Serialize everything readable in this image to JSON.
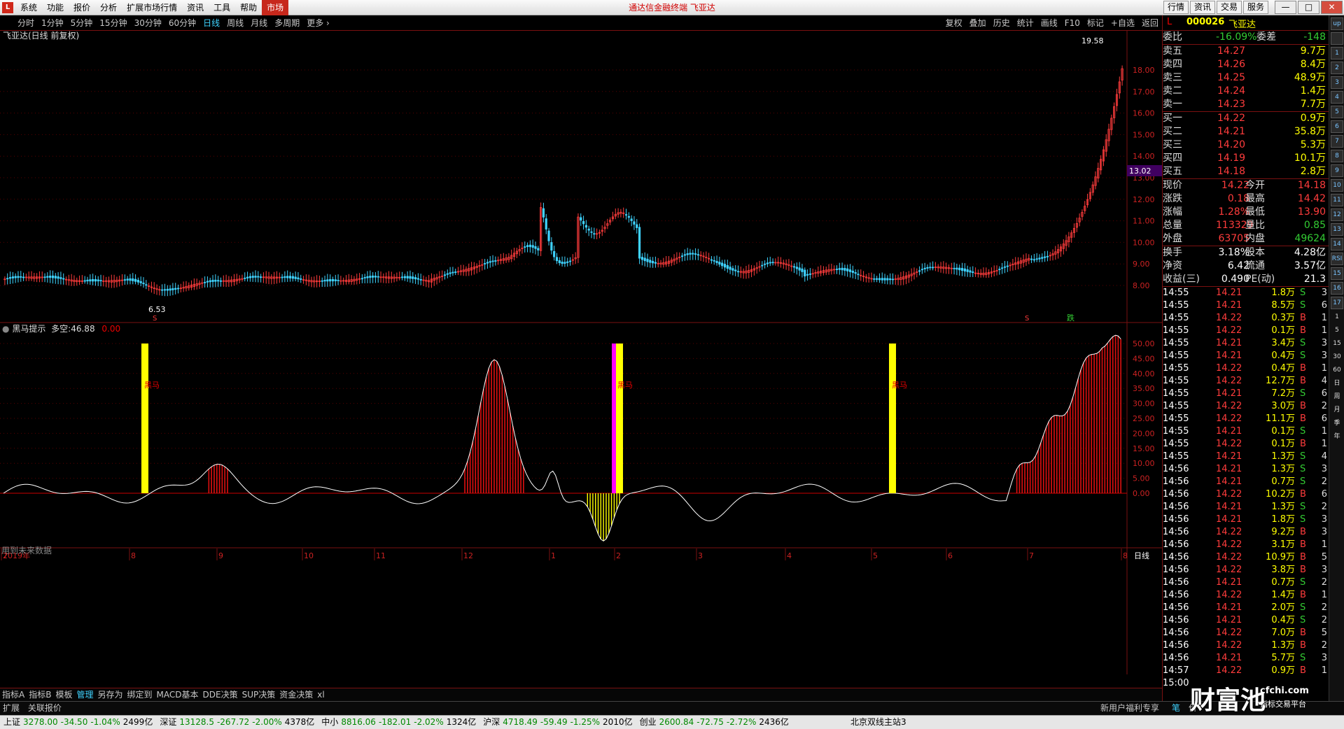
{
  "app": {
    "logo": "L",
    "title": "通达信金融终端  飞亚达",
    "menu": [
      "系统",
      "功能",
      "报价",
      "分析",
      "扩展市场行情",
      "资讯",
      "工具",
      "帮助",
      "市场"
    ],
    "top_buttons": [
      "行情",
      "资讯",
      "交易",
      "服务"
    ],
    "window_buttons": [
      "—",
      "□",
      "✕"
    ]
  },
  "periods": {
    "items": [
      "分时",
      "1分钟",
      "5分钟",
      "15分钟",
      "30分钟",
      "60分钟",
      "日线",
      "周线",
      "月线",
      "多周期",
      "更多"
    ],
    "selected": "日线",
    "more_icon": "chevron-right"
  },
  "tools": [
    "复权",
    "叠加",
    "历史",
    "统计",
    "画线",
    "F10",
    "标记",
    "+自选",
    "返回"
  ],
  "main_chart": {
    "title": "飞亚达(日线 前复权)",
    "high_label": "19.58",
    "low_label": "6.53",
    "price_tag": "13.02",
    "yticks": [
      "18.00",
      "17.00",
      "16.00",
      "15.00",
      "14.00",
      "13.00",
      "12.00",
      "11.00",
      "10.00",
      "9.00",
      "8.00"
    ],
    "marks": [
      "S",
      "S",
      "跌"
    ]
  },
  "indicator": {
    "name": "黑马提示",
    "label": "多空",
    "value": "46.88",
    "value2": "0.00",
    "yticks": [
      "50.00",
      "45.00",
      "40.00",
      "35.00",
      "30.00",
      "25.00",
      "20.00",
      "15.00",
      "10.00",
      "5.00",
      "0.00"
    ],
    "signal_text": "黑马",
    "future_note": "用到未来数据"
  },
  "x_axis": {
    "labels": [
      "2019年",
      "7",
      "8",
      "9",
      "10",
      "11",
      "12",
      "1",
      "2",
      "3",
      "4",
      "5",
      "6",
      "7",
      "8"
    ],
    "period": "日线"
  },
  "quote": {
    "code": "000026",
    "name": "飞亚达",
    "weibi_label": "委比",
    "weibi": "-16.09%",
    "weicha_label": "委差",
    "weicha": "-148",
    "sells": [
      {
        "label": "卖五",
        "price": "14.27",
        "vol": "9.7万"
      },
      {
        "label": "卖四",
        "price": "14.26",
        "vol": "8.4万"
      },
      {
        "label": "卖三",
        "price": "14.25",
        "vol": "48.9万"
      },
      {
        "label": "卖二",
        "price": "14.24",
        "vol": "1.4万"
      },
      {
        "label": "卖一",
        "price": "14.23",
        "vol": "7.7万"
      }
    ],
    "buys": [
      {
        "label": "买一",
        "price": "14.22",
        "vol": "0.9万"
      },
      {
        "label": "买二",
        "price": "14.21",
        "vol": "35.8万"
      },
      {
        "label": "买三",
        "price": "14.20",
        "vol": "5.3万"
      },
      {
        "label": "买四",
        "price": "14.19",
        "vol": "10.1万"
      },
      {
        "label": "买五",
        "price": "14.18",
        "vol": "2.8万"
      }
    ],
    "stats": [
      [
        "现价",
        "14.22",
        "今开",
        "14.18"
      ],
      [
        "涨跌",
        "0.18",
        "最高",
        "14.42"
      ],
      [
        "涨幅",
        "1.28%",
        "最低",
        "13.90"
      ],
      [
        "总量",
        "113329",
        "量比",
        "0.85"
      ],
      [
        "外盘",
        "63705",
        "内盘",
        "49624"
      ]
    ],
    "stats2": [
      [
        "换手",
        "3.18%",
        "股本",
        "4.28亿"
      ],
      [
        "净资",
        "6.42",
        "流通",
        "3.57亿"
      ],
      [
        "收益(三)",
        "0.490",
        "PE(动)",
        "21.3"
      ]
    ]
  },
  "ticks": [
    [
      "14:55",
      "14.21",
      "1.8万",
      "S",
      "3"
    ],
    [
      "14:55",
      "14.21",
      "8.5万",
      "S",
      "6"
    ],
    [
      "14:55",
      "14.22",
      "0.3万",
      "B",
      "1"
    ],
    [
      "14:55",
      "14.22",
      "0.1万",
      "B",
      "1"
    ],
    [
      "14:55",
      "14.21",
      "3.4万",
      "S",
      "3"
    ],
    [
      "14:55",
      "14.21",
      "0.4万",
      "S",
      "3"
    ],
    [
      "14:55",
      "14.22",
      "0.4万",
      "B",
      "1"
    ],
    [
      "14:55",
      "14.22",
      "12.7万",
      "B",
      "4"
    ],
    [
      "14:55",
      "14.21",
      "7.2万",
      "S",
      "6"
    ],
    [
      "14:55",
      "14.22",
      "3.0万",
      "B",
      "2"
    ],
    [
      "14:55",
      "14.22",
      "11.1万",
      "B",
      "6"
    ],
    [
      "14:55",
      "14.21",
      "0.1万",
      "S",
      "1"
    ],
    [
      "14:55",
      "14.22",
      "0.1万",
      "B",
      "1"
    ],
    [
      "14:55",
      "14.21",
      "1.3万",
      "S",
      "4"
    ],
    [
      "14:56",
      "14.21",
      "1.3万",
      "S",
      "3"
    ],
    [
      "14:56",
      "14.21",
      "0.7万",
      "S",
      "2"
    ],
    [
      "14:56",
      "14.22",
      "10.2万",
      "B",
      "6"
    ],
    [
      "14:56",
      "14.21",
      "1.3万",
      "S",
      "2"
    ],
    [
      "14:56",
      "14.21",
      "1.8万",
      "S",
      "3"
    ],
    [
      "14:56",
      "14.22",
      "9.2万",
      "B",
      "3"
    ],
    [
      "14:56",
      "14.22",
      "3.1万",
      "B",
      "1"
    ],
    [
      "14:56",
      "14.22",
      "10.9万",
      "B",
      "5"
    ],
    [
      "14:56",
      "14.22",
      "3.8万",
      "B",
      "3"
    ],
    [
      "14:56",
      "14.21",
      "0.7万",
      "S",
      "2"
    ],
    [
      "14:56",
      "14.22",
      "1.4万",
      "B",
      "1"
    ],
    [
      "14:56",
      "14.21",
      "2.0万",
      "S",
      "2"
    ],
    [
      "14:56",
      "14.21",
      "0.4万",
      "S",
      "2"
    ],
    [
      "14:56",
      "14.22",
      "7.0万",
      "B",
      "5"
    ],
    [
      "14:56",
      "14.22",
      "1.3万",
      "B",
      "2"
    ],
    [
      "14:56",
      "14.21",
      "5.7万",
      "S",
      "3"
    ],
    [
      "14:57",
      "14.22",
      "0.9万",
      "B",
      "1"
    ],
    [
      "15:00",
      "",
      "",
      "",
      ""
    ]
  ],
  "bottom_tabs": [
    "指标A",
    "指标B",
    "模板",
    "管理",
    "另存为",
    "绑定到",
    "MACD基本",
    "DDE决策",
    "SUP决策",
    "资金决策",
    "xl"
  ],
  "bottom_tabs_selected": "管理",
  "bottom2": {
    "left": [
      "扩展",
      "关联报价"
    ],
    "right": [
      "新用户福利专享",
      "笔",
      "价",
      "细",
      "势",
      "联",
      "值"
    ]
  },
  "statusbar": [
    [
      "上证",
      "3278.00",
      "-34.50",
      "-1.04%",
      "2499亿"
    ],
    [
      "深证",
      "13128.5",
      "-267.72",
      "-2.00%",
      "4378亿"
    ],
    [
      "中小",
      "8816.06",
      "-182.01",
      "-2.02%",
      "1324亿"
    ],
    [
      "沪深",
      "4718.49",
      "-59.49",
      "-1.25%",
      "2010亿"
    ],
    [
      "创业",
      "2600.84",
      "-72.75",
      "-2.72%",
      "2436亿"
    ]
  ],
  "status_right": "北京双线主站3",
  "watermark": {
    "main": "财富池",
    "url": "cfchi.com",
    "sub": "指标交易平台"
  },
  "sidebar_icons": [
    "up",
    "down",
    "1",
    "2",
    "3",
    "4",
    "5",
    "6",
    "7",
    "8",
    "9",
    "10",
    "11",
    "12",
    "13",
    "14",
    "RSI",
    "15",
    "16",
    "17"
  ],
  "sidebar_periods": [
    "1",
    "5",
    "15",
    "30",
    "60",
    "日",
    "周",
    "月",
    "季",
    "年"
  ]
}
